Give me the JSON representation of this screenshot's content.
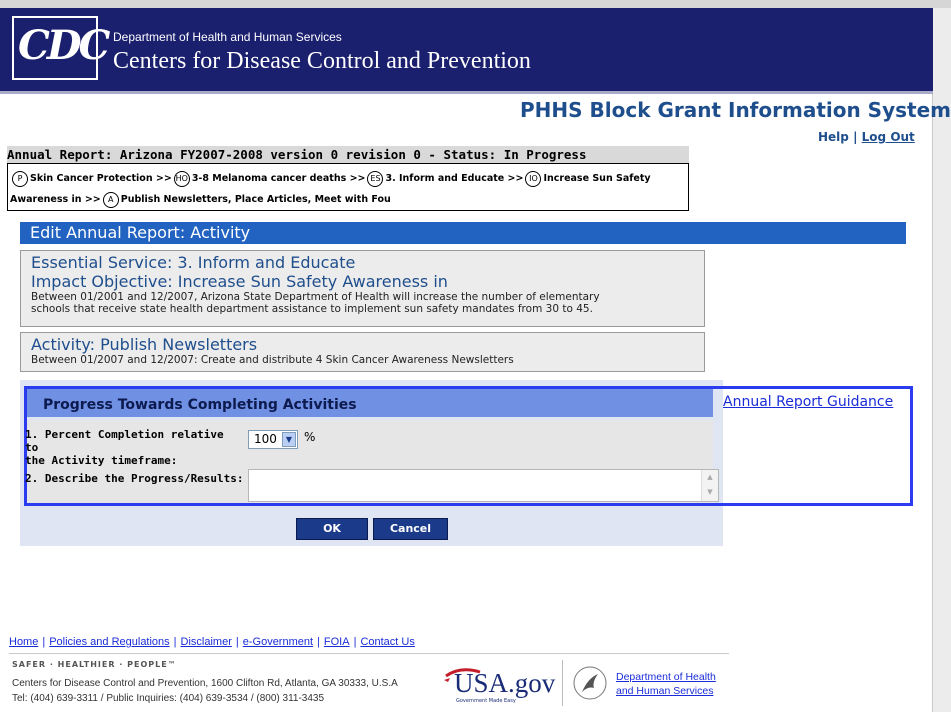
{
  "header": {
    "logo_text": "CDC",
    "department": "Department of Health and Human Services",
    "center_name": "Centers for Disease Control and Prevention"
  },
  "system": {
    "title": "PHHS Block Grant Information System",
    "help": "Help",
    "separator": "|",
    "logout": "Log Out"
  },
  "report": {
    "status_line": "Annual Report: Arizona FY2007-2008 version 0 revision 0 - Status: In Progress"
  },
  "breadcrumb": {
    "items": [
      {
        "badge": "P",
        "label": "Skin Cancer Protection"
      },
      {
        "badge": "HO",
        "label": "3-8 Melanoma cancer deaths"
      },
      {
        "badge": "ES",
        "label": "3. Inform and Educate"
      },
      {
        "badge": "IO",
        "label": "Increase Sun Safety Awareness in"
      },
      {
        "badge": "A",
        "label": "Publish Newsletters, Place Articles, Meet with Fou"
      }
    ],
    "separator": ">>"
  },
  "main": {
    "edit_title": "Edit Annual Report: Activity",
    "essential_service": "Essential Service: 3. Inform and Educate",
    "impact_objective": "Impact Objective: Increase Sun Safety Awareness in",
    "impact_desc_1": "Between 01/2001 and 12/2007, Arizona State Department of Health will increase the number of elementary",
    "impact_desc_2": "schools that receive state health department assistance to implement sun safety mandates from 30 to 45.",
    "activity_title": "Activity: Publish Newsletters",
    "activity_desc": "Between 01/2007 and 12/2007: Create and distribute 4 Skin Cancer Awareness Newsletters"
  },
  "progress": {
    "title": "Progress Towards Completing Activities",
    "guidance_link": "Annual Report Guidance",
    "q1_label_1": "1. Percent Completion relative to",
    "q1_label_2": "the Activity timeframe:",
    "percent_value": "100",
    "percent_unit": "%",
    "q2_label": "2. Describe the Progress/Results:",
    "description_value": ""
  },
  "buttons": {
    "ok": "OK",
    "cancel": "Cancel"
  },
  "footer": {
    "links": [
      "Home",
      "Policies and Regulations",
      "Disclaimer",
      "e-Government",
      "FOIA",
      "Contact Us"
    ],
    "tagline": "SAFER · HEALTHIER · PEOPLE™",
    "address": "Centers for Disease Control and Prevention, 1600 Clifton Rd, Atlanta, GA 30333, U.S.A",
    "phone": "Tel: (404) 639-3311 / Public Inquiries: (404) 639-3534 / (800) 311-3435",
    "usa_gov": "USA.gov",
    "usa_gov_sub": "Government Made Easy",
    "hhs_link": "Department of Health and Human Services"
  },
  "colors": {
    "header_bg": "#1a1f6e",
    "accent_blue": "#2263c1",
    "progress_border": "#2a3bf0",
    "button_bg": "#1b3b8a"
  }
}
